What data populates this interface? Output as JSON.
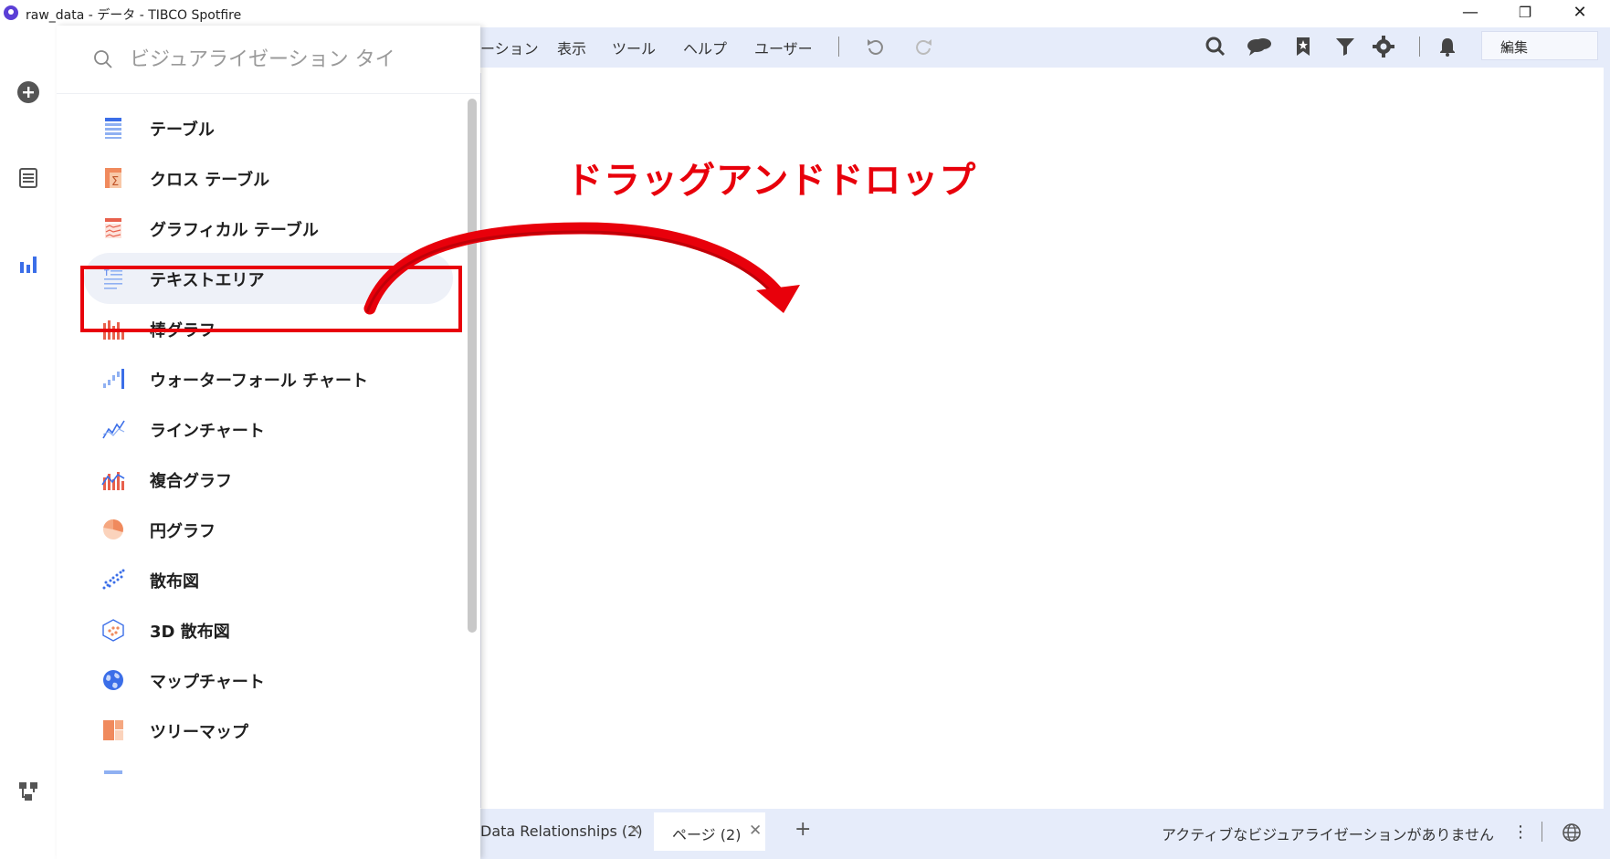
{
  "window": {
    "title": "raw_data - データ - TIBCO Spotfire",
    "minimize": "—",
    "restore": "❐",
    "close": "✕"
  },
  "rail": {
    "icons": [
      "add-icon",
      "data-table-icon",
      "bar-chart-icon",
      "data-relationships-icon"
    ]
  },
  "menubar": {
    "items": [
      "ーション",
      "表示",
      "ツール",
      "ヘルプ",
      "ユーザー"
    ],
    "toolbar_icons": [
      "undo-icon",
      "redo-icon",
      "search-icon",
      "comments-icon",
      "bookmark-icon",
      "filter-icon",
      "settings-icon",
      "notifications-icon"
    ],
    "mode_select": {
      "value": "編集",
      "chevron": "⌄"
    }
  },
  "panel": {
    "search_placeholder": "ビジュアライゼーション タイ",
    "items": [
      {
        "label": "テーブル",
        "icon": "table-icon"
      },
      {
        "label": "クロス テーブル",
        "icon": "cross-table-icon"
      },
      {
        "label": "グラフィカル テーブル",
        "icon": "graphical-table-icon"
      },
      {
        "label": "テキストエリア",
        "icon": "text-area-icon",
        "selected": true
      },
      {
        "label": "棒グラフ",
        "icon": "bar-chart-icon"
      },
      {
        "label": "ウォーターフォール チャート",
        "icon": "waterfall-chart-icon"
      },
      {
        "label": "ラインチャート",
        "icon": "line-chart-icon"
      },
      {
        "label": "複合グラフ",
        "icon": "combination-chart-icon"
      },
      {
        "label": "円グラフ",
        "icon": "pie-chart-icon"
      },
      {
        "label": "散布図",
        "icon": "scatter-plot-icon"
      },
      {
        "label": "3D 散布図",
        "icon": "scatter-3d-icon"
      },
      {
        "label": "マップチャート",
        "icon": "map-chart-icon"
      },
      {
        "label": "ツリーマップ",
        "icon": "treemap-icon"
      }
    ]
  },
  "annotation": {
    "text": "ドラッグアンドドロップ",
    "color": "#e8000b"
  },
  "bottombar": {
    "tabs": [
      {
        "label": "Data Relationships (2)",
        "close": "✕"
      },
      {
        "label": "ページ (2)",
        "close": "✕",
        "active": true
      }
    ],
    "add_page": "+",
    "status": "アクティブなビジュアライゼーションがありません",
    "more": "⋮"
  },
  "colors": {
    "accent_blue": "#3b6ee8",
    "menubar_bg": "#e6ecfa",
    "chart_orange": "#f08a5d",
    "chart_red": "#e8604c"
  }
}
